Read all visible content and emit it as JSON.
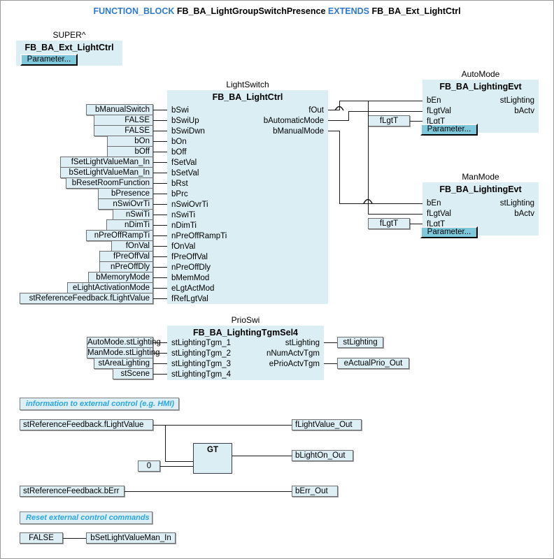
{
  "title": {
    "kw1": "FUNCTION_BLOCK",
    "name": "FB_BA_LightGroupSwitchPresence",
    "kw2": "EXTENDS",
    "base": "FB_BA_Ext_LightCtrl"
  },
  "colors": {
    "block_fill": "#daeef3",
    "var_fill": "#ddeef5",
    "comment_text": "#2aa6e0",
    "keyword": "#2f79c8",
    "button_fill": "#7ec8dc",
    "wire": "#1a1a1a"
  },
  "super_block": {
    "instance": "SUPER^",
    "type": "FB_BA_Ext_LightCtrl",
    "button": "Parameter..."
  },
  "light_switch": {
    "instance": "LightSwitch",
    "type": "FB_BA_LightCtrl",
    "inputs": [
      {
        "pin": "bSwi",
        "source": "bManualSwitch"
      },
      {
        "pin": "bSwiUp",
        "source": "FALSE"
      },
      {
        "pin": "bSwiDwn",
        "source": "FALSE"
      },
      {
        "pin": "bOn",
        "source": "bOn"
      },
      {
        "pin": "bOff",
        "source": "bOff"
      },
      {
        "pin": "fSetVal",
        "source": "fSetLightValueMan_In"
      },
      {
        "pin": "bSetVal",
        "source": "bSetLightValueMan_In"
      },
      {
        "pin": "bRst",
        "source": "bResetRoomFunction"
      },
      {
        "pin": "bPrc",
        "source": "bPresence"
      },
      {
        "pin": "nSwiOvrTi",
        "source": "nSwiOvrTi"
      },
      {
        "pin": "nSwiTi",
        "source": "nSwiTi"
      },
      {
        "pin": "nDimTi",
        "source": "nDimTi"
      },
      {
        "pin": "nPreOffRampTi",
        "source": "nPreOffRampTi"
      },
      {
        "pin": "fOnVal",
        "source": "fOnVal"
      },
      {
        "pin": "fPreOffVal",
        "source": "fPreOffVal"
      },
      {
        "pin": "nPreOffDly",
        "source": "nPreOffDly"
      },
      {
        "pin": "bMemMod",
        "source": "bMemoryMode"
      },
      {
        "pin": "eLgtActMod",
        "source": "eLightActivationMode"
      },
      {
        "pin": "fRefLgtVal",
        "source": "stReferenceFeedback.fLightValue"
      }
    ],
    "outputs": [
      {
        "pin": "fOut"
      },
      {
        "pin": "bAutomaticMode"
      },
      {
        "pin": "bManualMode"
      }
    ]
  },
  "auto_mode": {
    "instance": "AutoMode",
    "type": "FB_BA_LightingEvt",
    "inputs": [
      {
        "pin": "bEn"
      },
      {
        "pin": "fLgtVal"
      },
      {
        "pin": "fLgtT",
        "source": "fLgtT"
      }
    ],
    "outputs": [
      {
        "pin": "stLighting"
      },
      {
        "pin": "bActv"
      }
    ],
    "button": "Parameter..."
  },
  "man_mode": {
    "instance": "ManMode",
    "type": "FB_BA_LightingEvt",
    "inputs": [
      {
        "pin": "bEn"
      },
      {
        "pin": "fLgtVal"
      },
      {
        "pin": "fLgtT",
        "source": "fLgtT"
      }
    ],
    "outputs": [
      {
        "pin": "stLighting"
      },
      {
        "pin": "bActv"
      }
    ],
    "button": "Parameter..."
  },
  "prio_swi": {
    "instance": "PrioSwi",
    "type": "FB_BA_LightingTgmSel4",
    "inputs": [
      {
        "pin": "stLightingTgm_1",
        "source": "AutoMode.stLighting"
      },
      {
        "pin": "stLightingTgm_2",
        "source": "ManMode.stLighting"
      },
      {
        "pin": "stLightingTgm_3",
        "source": "stAreaLighting"
      },
      {
        "pin": "stLightingTgm_4",
        "source": "stScene"
      }
    ],
    "outputs": [
      {
        "pin": "stLighting",
        "target": "stLighting"
      },
      {
        "pin": "nNumActvTgm",
        "target": ""
      },
      {
        "pin": "ePrioActvTgm",
        "target": "eActualPrio_Out"
      }
    ]
  },
  "hmi_section": {
    "comment": "information to external control (e.g. HMI)",
    "light_value_source": "stReferenceFeedback.fLightValue",
    "light_value_out": "fLightValue_Out",
    "gt_operator": "GT",
    "gt_constant": "0",
    "light_on_out": "bLightOn_Out",
    "err_source": "stReferenceFeedback.bErr",
    "err_out": "bErr_Out"
  },
  "reset_section": {
    "comment": "Reset external control commands",
    "const": "FALSE",
    "target": "bSetLightValueMan_In"
  }
}
